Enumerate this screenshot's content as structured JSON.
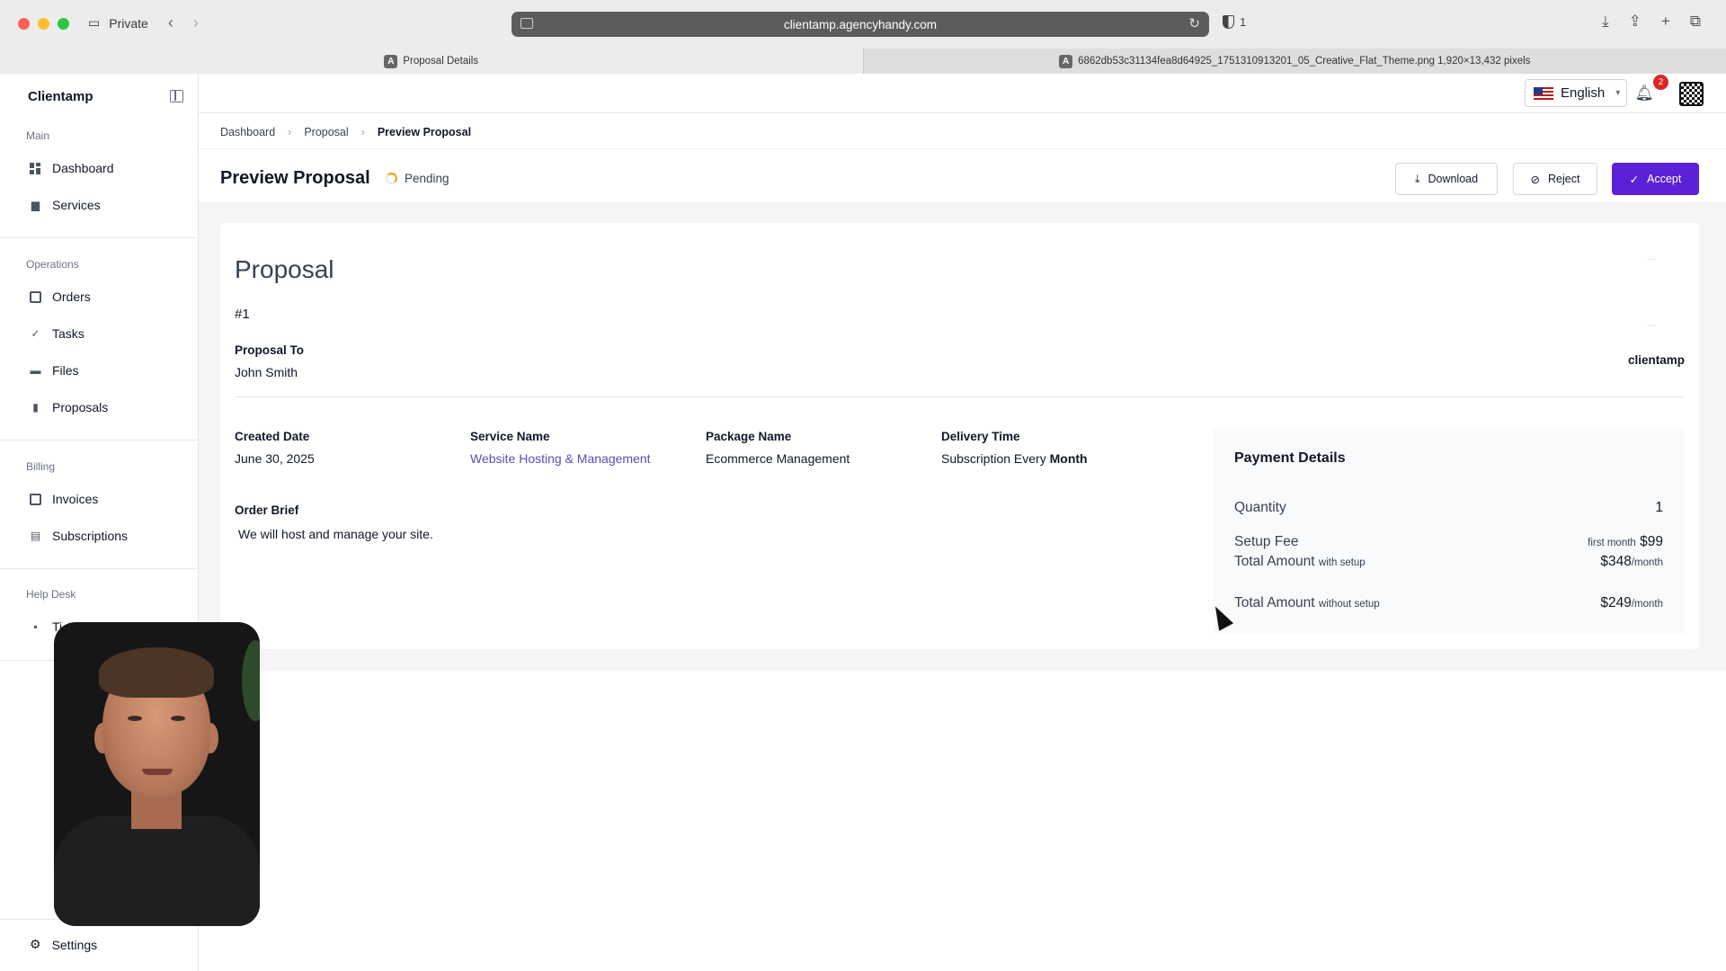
{
  "browser": {
    "private_label": "Private",
    "url": "clientamp.agencyhandy.com",
    "shield_count": "1",
    "tabs": [
      {
        "label": "Proposal Details",
        "favicon": "A"
      },
      {
        "label": "6862db53c31134fea8d64925_1751310913201_05_Creative_Flat_Theme.png 1,920×13,432 pixels",
        "favicon": "A"
      }
    ]
  },
  "sidebar": {
    "brand": "Clientamp",
    "sections": {
      "main": "Main",
      "operations": "Operations",
      "billing": "Billing",
      "helpdesk": "Help Desk"
    },
    "items": {
      "dashboard": "Dashboard",
      "services": "Services",
      "orders": "Orders",
      "tasks": "Tasks",
      "files": "Files",
      "proposals": "Proposals",
      "invoices": "Invoices",
      "subscriptions": "Subscriptions",
      "tickets_partial": "Ti",
      "settings": "Settings"
    }
  },
  "header": {
    "language": "English",
    "notification_count": "2"
  },
  "breadcrumb": [
    "Dashboard",
    "Proposal",
    "Preview Proposal"
  ],
  "page": {
    "title": "Preview Proposal",
    "status": "Pending",
    "buttons": {
      "download": "Download",
      "reject": "Reject",
      "accept": "Accept"
    }
  },
  "proposal": {
    "heading": "Proposal",
    "number": "#1",
    "to_label": "Proposal To",
    "to_value": "John Smith",
    "company": "clientamp",
    "created_label": "Created Date",
    "created_value": "June 30, 2025",
    "service_label": "Service Name",
    "service_value": "Website Hosting & Management",
    "package_label": "Package Name",
    "package_value": "Ecommerce Management",
    "delivery_label": "Delivery Time",
    "delivery_prefix": "Subscription Every",
    "delivery_unit": "Month",
    "brief_label": "Order Brief",
    "brief_value": "We will host and manage your site."
  },
  "payment": {
    "title": "Payment Details",
    "quantity_label": "Quantity",
    "quantity_value": "1",
    "setup_label": "Setup Fee",
    "setup_note": "first month",
    "setup_value": "$99",
    "total_with_label": "Total Amount",
    "total_with_note": "with setup",
    "total_with_value": "$348",
    "total_without_label": "Total Amount",
    "total_without_note": "without setup",
    "total_without_value": "$249",
    "per": "/month"
  },
  "colors": {
    "accent": "#5b21d6",
    "link": "#5b4bb4",
    "badge": "#dc2626",
    "pending": "#f59e0b"
  }
}
